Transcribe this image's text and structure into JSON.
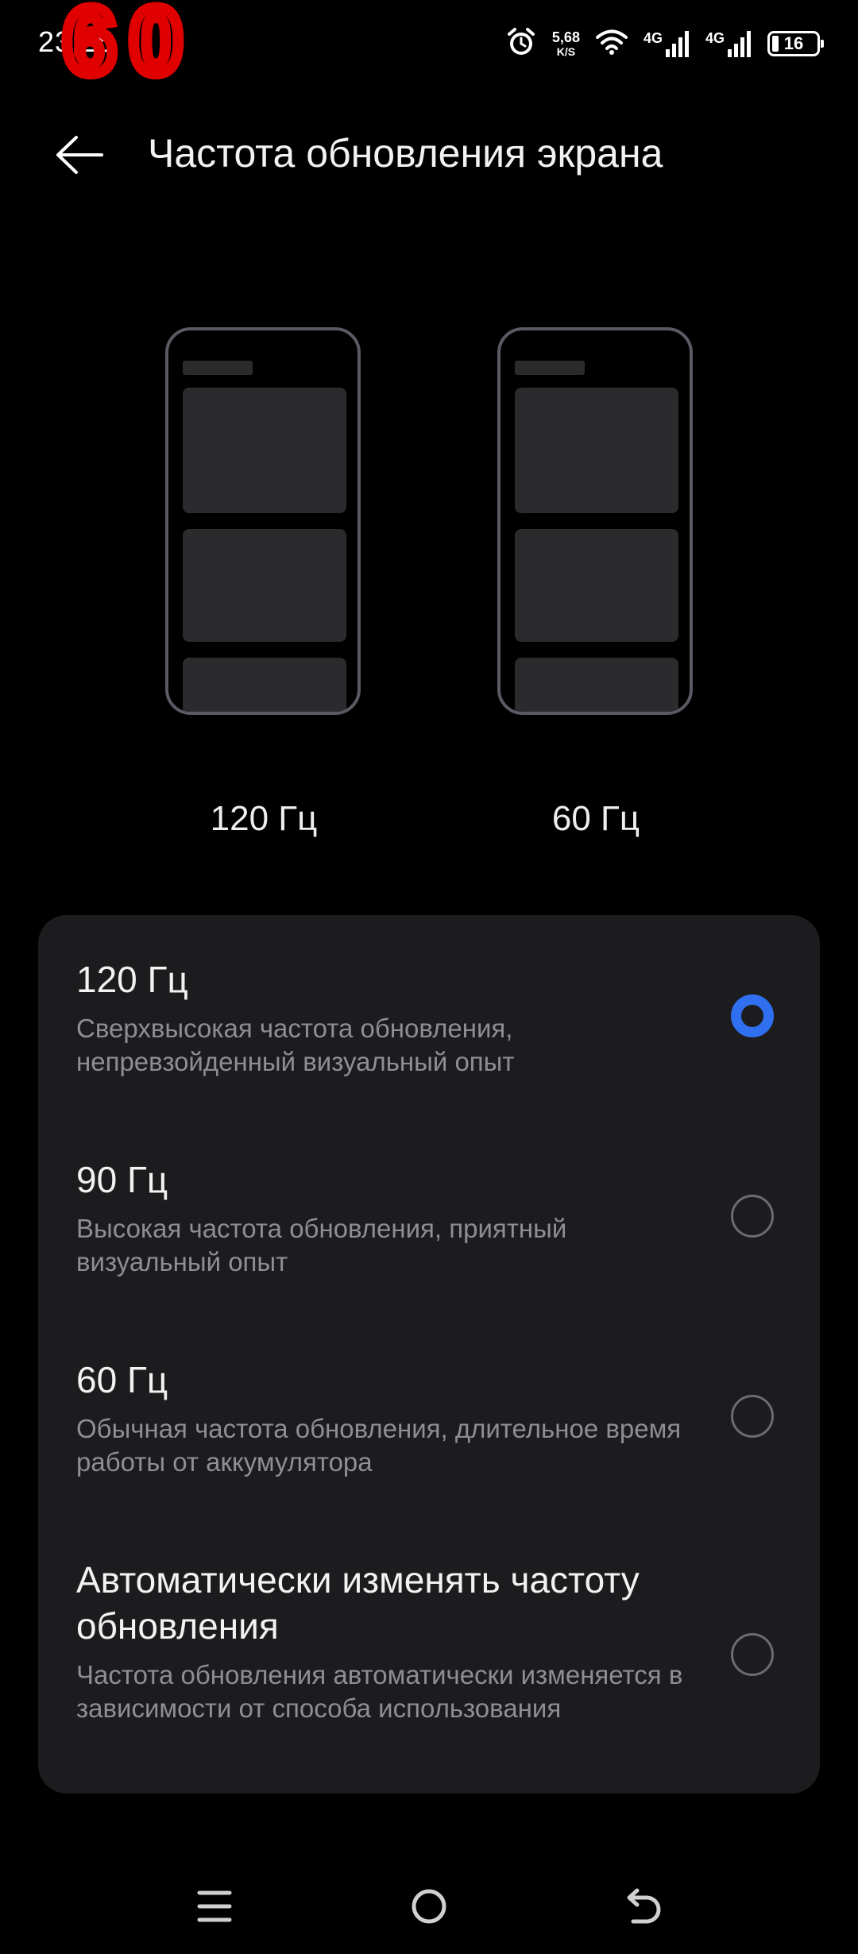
{
  "status_bar": {
    "time": "23:25",
    "fps_overlay": "60",
    "net_speed_value": "5,68",
    "net_speed_unit": "K/S",
    "sim1_label": "4G",
    "sim2_label": "4G",
    "battery_level": "16"
  },
  "header": {
    "title": "Частота обновления экрана"
  },
  "preview": {
    "left_label": "120 Гц",
    "right_label": "60 Гц"
  },
  "options": [
    {
      "title": "120 Гц",
      "description": "Сверхвысокая частота обновления, непревзойденный визуальный опыт",
      "selected": true
    },
    {
      "title": "90 Гц",
      "description": "Высокая частота обновления, приятный визуальный опыт",
      "selected": false
    },
    {
      "title": "60 Гц",
      "description": "Обычная частота обновления, длительное время работы от аккумулятора",
      "selected": false
    },
    {
      "title": "Автоматически изменять частоту обновления",
      "description": "Частота обновления автоматически изменяется в зависимости от способа использования",
      "selected": false
    }
  ],
  "colors": {
    "background": "#000000",
    "card": "#1c1c1e",
    "accent": "#2f6ff0",
    "secondary_text": "#8e8e93"
  },
  "icons": {
    "back": "arrow-left-icon",
    "alarm": "alarm-icon",
    "wifi": "wifi-icon",
    "signal": "signal-icon",
    "battery": "battery-icon",
    "nav_menu": "menu-icon",
    "nav_home": "home-circle-icon",
    "nav_back": "return-icon"
  }
}
